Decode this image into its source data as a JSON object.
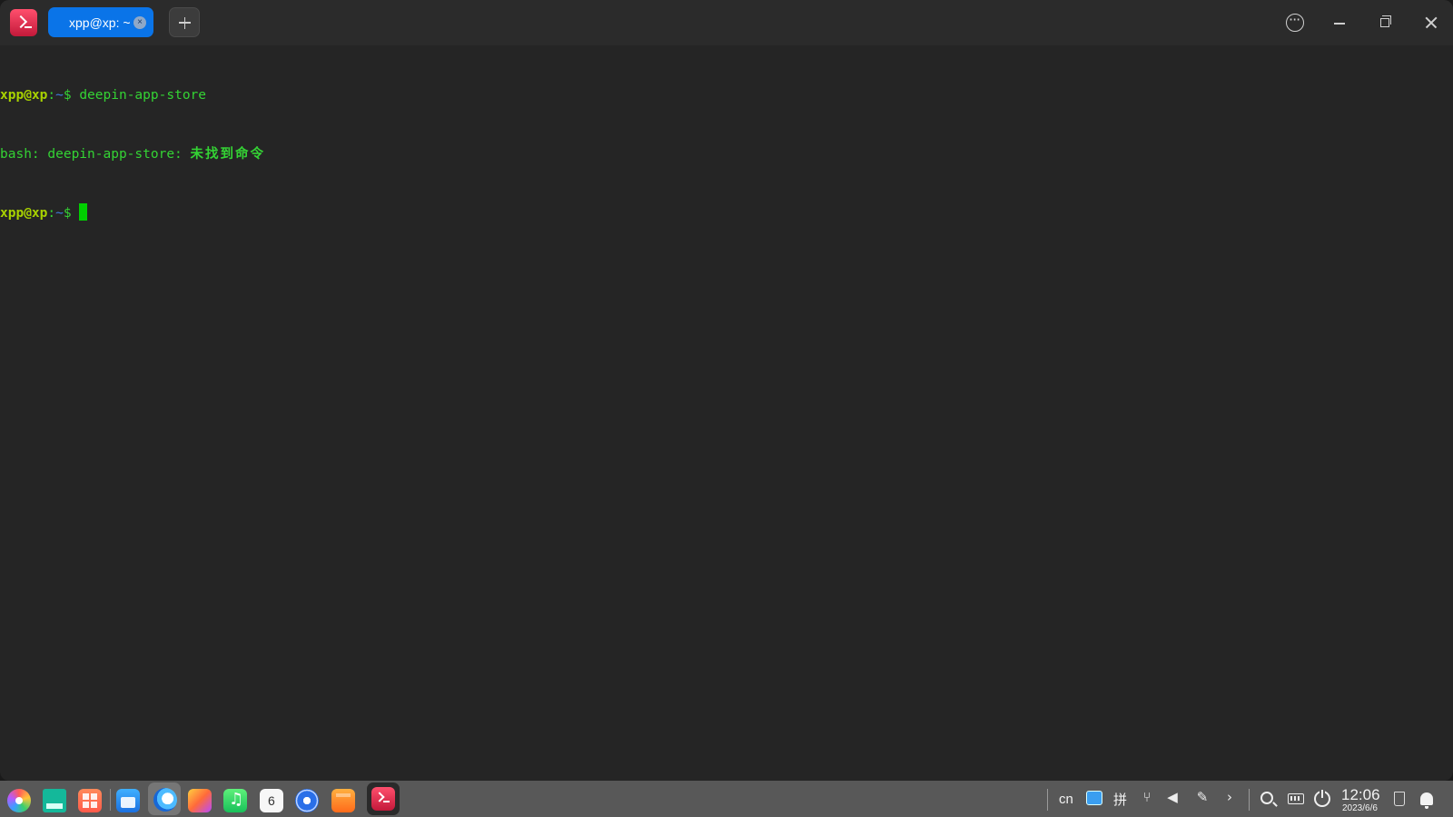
{
  "window": {
    "tab_title": "xpp@xp: ~",
    "tab_close_glyph": "×"
  },
  "terminal": {
    "lines": [
      {
        "user": "xpp@xp",
        "sep": ":",
        "path": "~",
        "sign": "$",
        "command": "deepin-app-store"
      },
      {
        "output_prefix": "bash: deepin-app-store: ",
        "output_cn": "未找到命令"
      },
      {
        "user": "xpp@xp",
        "sep": ":",
        "path": "~",
        "sign": "$",
        "command": ""
      }
    ]
  },
  "dock": {
    "apps": [
      {
        "name": "launcher-icon"
      },
      {
        "name": "file-manager-icon"
      },
      {
        "name": "app-launcher-grid-icon"
      },
      {
        "name": "app-store-icon"
      },
      {
        "name": "browser-icon"
      },
      {
        "name": "image-viewer-icon"
      },
      {
        "name": "music-icon"
      },
      {
        "name": "calendar-icon",
        "day": "6"
      },
      {
        "name": "settings-icon"
      },
      {
        "name": "archive-icon"
      },
      {
        "name": "terminal-icon"
      }
    ]
  },
  "tray": {
    "lang": "cn",
    "ime": "拼",
    "time": "12:06",
    "date": "2023/6/6"
  },
  "colors": {
    "tab_active": "#0a74e8",
    "prompt_user": "#a8d200",
    "prompt_path": "#3e7ee0",
    "terminal_text": "#34d334",
    "cursor": "#00cf00"
  }
}
